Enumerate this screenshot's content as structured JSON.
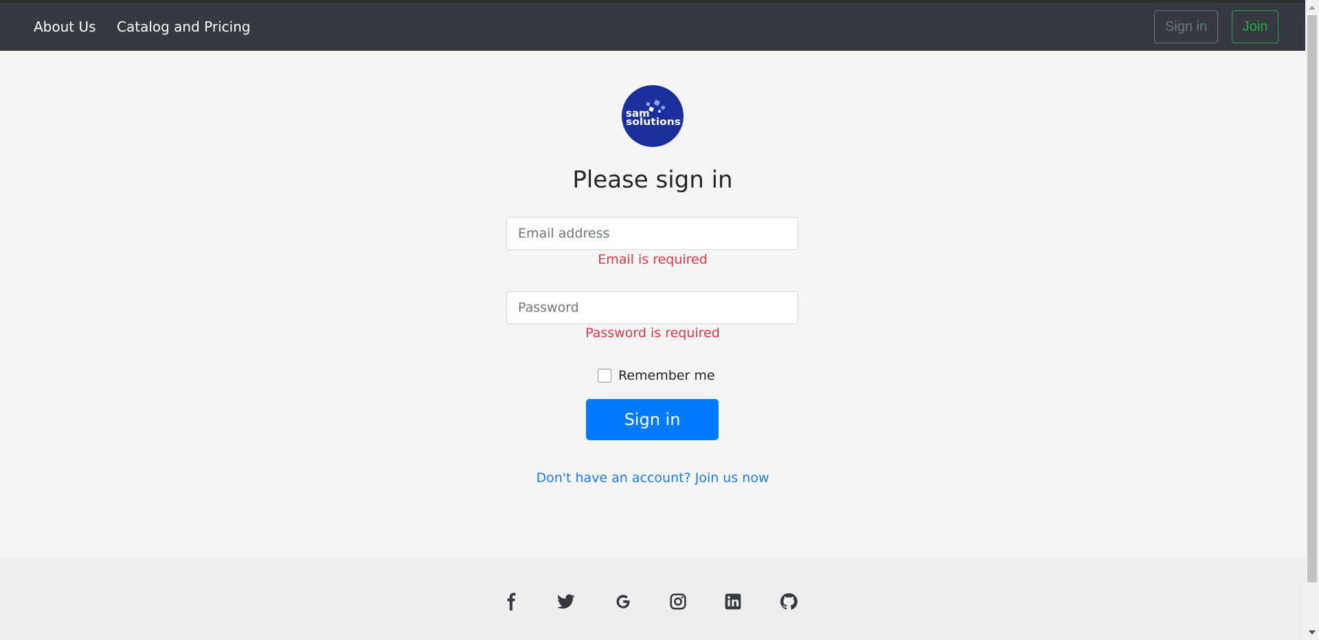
{
  "navbar": {
    "links": [
      "About Us",
      "Catalog and Pricing"
    ],
    "signin_label": "Sign in",
    "join_label": "Join"
  },
  "logo": {
    "line1": "sam",
    "line2": "solutions",
    "color": "#1a2f9c"
  },
  "form": {
    "title": "Please sign in",
    "email_placeholder": "Email address",
    "email_error": "Email is required",
    "password_placeholder": "Password",
    "password_error": "Password is required",
    "remember_label": "Remember me",
    "remember_checked": false,
    "submit_label": "Sign in",
    "join_link": "Don't have an account? Join us now"
  },
  "footer": {
    "social_icons": [
      "facebook-icon",
      "twitter-icon",
      "google-icon",
      "instagram-icon",
      "linkedin-icon",
      "github-icon"
    ]
  },
  "colors": {
    "navbar": "#343a40",
    "primary": "#007bff",
    "error": "#dc3545",
    "join": "#28a745",
    "link": "#1e7ae0"
  }
}
